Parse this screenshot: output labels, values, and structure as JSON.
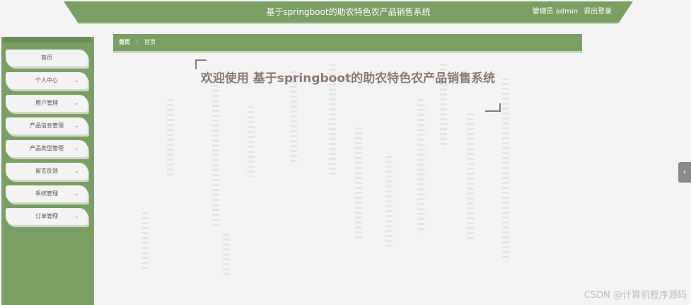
{
  "header": {
    "title": "基于springboot的助农特色农产品销售系统",
    "admin_label": "管理员 admin",
    "logout_label": "退出登录"
  },
  "sidebar": {
    "items": [
      {
        "label": "首页",
        "has_submenu": false
      },
      {
        "label": "个人中心",
        "has_submenu": true
      },
      {
        "label": "用户管理",
        "has_submenu": true
      },
      {
        "label": "产品信息管理",
        "has_submenu": true
      },
      {
        "label": "产品类型管理",
        "has_submenu": true
      },
      {
        "label": "留言反馈",
        "has_submenu": true
      },
      {
        "label": "系统管理",
        "has_submenu": true
      },
      {
        "label": "订单管理",
        "has_submenu": true
      }
    ]
  },
  "breadcrumb": {
    "root": "首页",
    "separator": "⋮",
    "current": "首页"
  },
  "main": {
    "welcome": "欢迎使用 基于springboot的助农特色农产品销售系统"
  },
  "side_tab": {
    "glyph": "‹"
  },
  "watermark": "CSDN @计算机程序源码",
  "colors": {
    "accent": "#7a9f63",
    "welcome_text": "#8a7a70",
    "background": "#f4f4f5"
  }
}
